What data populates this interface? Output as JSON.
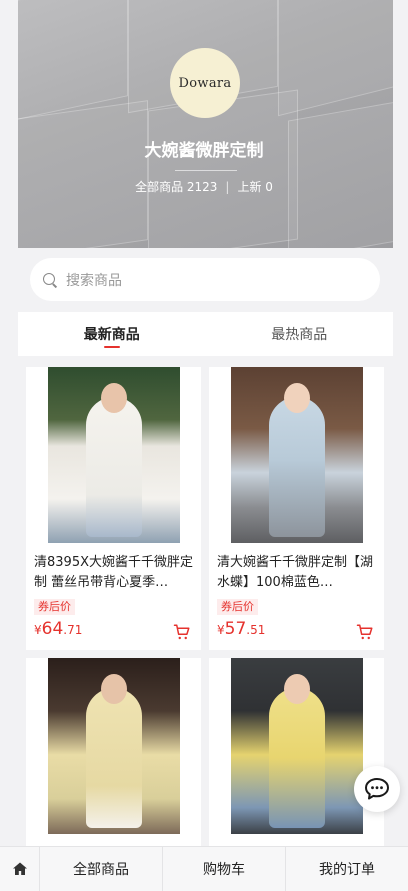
{
  "shop": {
    "logo_text": "Dowara",
    "name": "大婉酱微胖定制",
    "all_products_label": "全部商品 2123",
    "new_label": "上新 0"
  },
  "search": {
    "placeholder": "搜索商品"
  },
  "tabs": [
    {
      "label": "最新商品",
      "active": true
    },
    {
      "label": "最热商品",
      "active": false
    }
  ],
  "products": [
    {
      "title": "清8395X大婉酱千千微胖定制 蕾丝吊带背心夏季…",
      "tag": "券后价",
      "currency": "¥",
      "price_int": "64",
      "price_dec": ".71"
    },
    {
      "title": "清大婉酱千千微胖定制【湖水蝶】100棉蓝色…",
      "tag": "券后价",
      "currency": "¥",
      "price_int": "57",
      "price_dec": ".51"
    },
    {
      "title": "",
      "tag": "",
      "currency": "",
      "price_int": "",
      "price_dec": ""
    },
    {
      "title": "",
      "tag": "",
      "currency": "",
      "price_int": "",
      "price_dec": ""
    }
  ],
  "bottom_nav": {
    "home_icon": "home-icon",
    "items": [
      {
        "label": "全部商品"
      },
      {
        "label": "购物车"
      },
      {
        "label": "我的订单"
      }
    ]
  },
  "chat_fab": {
    "icon": "chat-bubble-icon"
  },
  "colors": {
    "accent": "#e5322d",
    "logo_bg": "#f6f0d3"
  }
}
